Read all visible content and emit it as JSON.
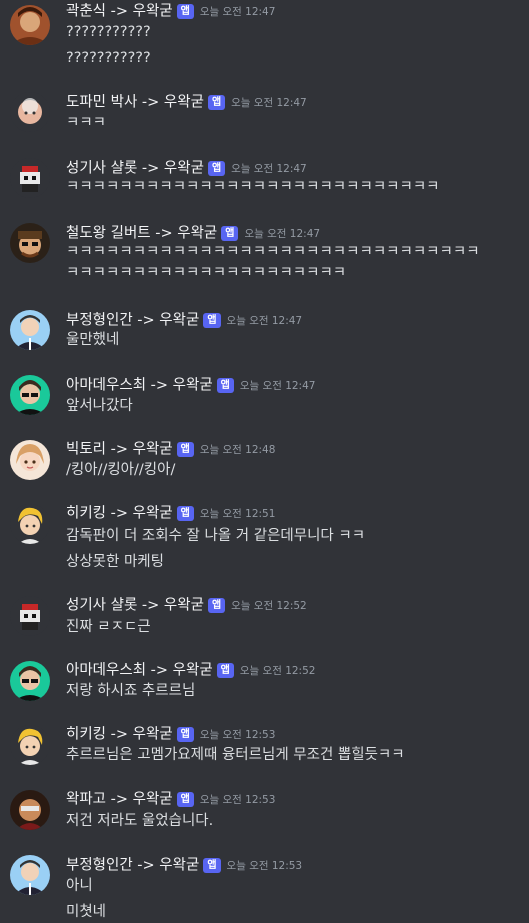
{
  "messages": [
    {
      "author": "곽춘식 -> 우왁굳",
      "badge": "앱",
      "time": "오늘 오전 12:47",
      "lines": [
        "???????????",
        "???????????"
      ]
    },
    {
      "author": "도파민 박사 -> 우왁굳",
      "badge": "앱",
      "time": "오늘 오전 12:47",
      "lines": [
        "ㅋㅋㅋ"
      ]
    },
    {
      "author": "성기사 샬롯 -> 우왁굳",
      "badge": "앱",
      "time": "오늘 오전 12:47",
      "lines": [
        "ㅋㅋㅋㅋㅋㅋㅋㅋㅋㅋㅋㅋㅋㅋㅋㅋㅋㅋㅋㅋㅋㅋㅋㅋㅋㅋㅋㅋ"
      ]
    },
    {
      "author": "철도왕 길버트 -> 우왁굳",
      "badge": "앱",
      "time": "오늘 오전 12:47",
      "lines": [
        "ㅋㅋㅋㅋㅋㅋㅋㅋㅋㅋㅋㅋㅋㅋㅋㅋㅋㅋㅋㅋㅋㅋㅋㅋㅋㅋㅋㅋㅋㅋㅋ",
        "ㅋㅋㅋㅋㅋㅋㅋㅋㅋㅋㅋㅋㅋㅋㅋㅋㅋㅋㅋㅋㅋ"
      ]
    },
    {
      "author": "부정형인간 -> 우왁굳",
      "badge": "앱",
      "time": "오늘 오전 12:47",
      "lines": [
        "울만했네"
      ]
    },
    {
      "author": "아마데우스최 -> 우왁굳",
      "badge": "앱",
      "time": "오늘 오전 12:47",
      "lines": [
        "앞서나갔다"
      ]
    },
    {
      "author": "빅토리 -> 우왁굳",
      "badge": "앱",
      "time": "오늘 오전 12:48",
      "lines": [
        "/킹아//킹아//킹아/"
      ]
    },
    {
      "author": "히키킹 -> 우왁굳",
      "badge": "앱",
      "time": "오늘 오전 12:51",
      "lines": [
        "감독판이 더 조회수 잘 나올 거 같은데무니다 ㅋㅋ",
        "상상못한 마케팅"
      ]
    },
    {
      "author": "성기사 샬롯 -> 우왁굳",
      "badge": "앱",
      "time": "오늘 오전 12:52",
      "lines": [
        "진짜 ㄹㅈㄷ근"
      ]
    },
    {
      "author": "아마데우스최 -> 우왁굳",
      "badge": "앱",
      "time": "오늘 오전 12:52",
      "lines": [
        "저랑 하시죠 추르르님"
      ]
    },
    {
      "author": "히키킹 -> 우왁굳",
      "badge": "앱",
      "time": "오늘 오전 12:53",
      "lines": [
        "추르르님은 고멤가요제때 융터르님게 무조건 뽑힐듯ㅋㅋ"
      ]
    },
    {
      "author": "왁파고 -> 우왁굳",
      "badge": "앱",
      "time": "오늘 오전 12:53",
      "lines": [
        "저건 저라도 울었습니다."
      ]
    },
    {
      "author": "부정형인간 -> 우왁굳",
      "badge": "앱",
      "time": "오늘 오전 12:53",
      "lines": [
        "아니",
        "미쳣네"
      ]
    }
  ]
}
